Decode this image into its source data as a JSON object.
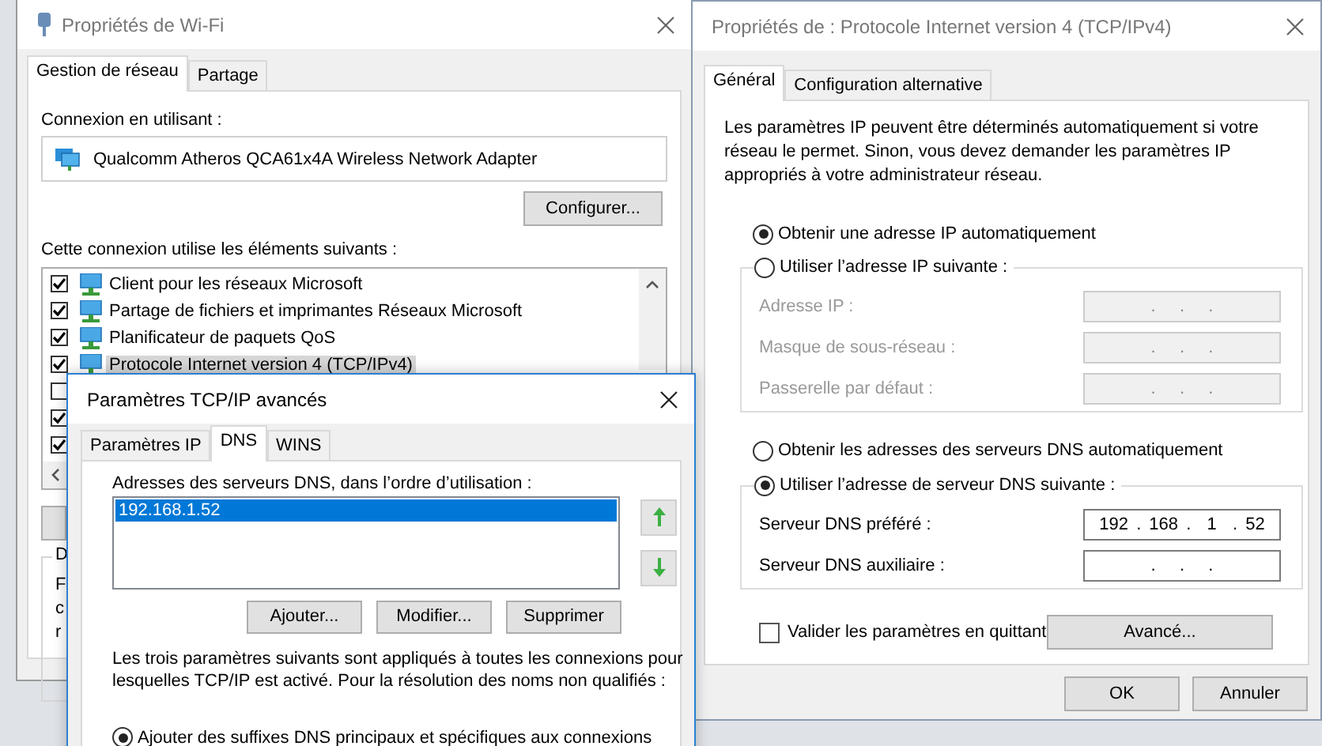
{
  "wifi_window": {
    "title": "Propriétés de Wi-Fi",
    "tabs": [
      {
        "label": "Gestion de réseau",
        "selected": true
      },
      {
        "label": "Partage",
        "selected": false
      }
    ],
    "connect_using_label": "Connexion en utilisant :",
    "adapter": "Qualcomm Atheros QCA61x4A Wireless Network Adapter",
    "configure_button": "Configurer...",
    "components_label": "Cette connexion utilise les éléments suivants :",
    "components": [
      {
        "label": "Client pour les réseaux Microsoft",
        "checked": true,
        "selected": false
      },
      {
        "label": "Partage de fichiers et imprimantes Réseaux Microsoft",
        "checked": true,
        "selected": false
      },
      {
        "label": "Planificateur de paquets QoS",
        "checked": true,
        "selected": false
      },
      {
        "label": "Protocole Internet version 4 (TCP/IPv4)",
        "checked": true,
        "selected": true
      },
      {
        "checked": false
      },
      {
        "checked": true
      },
      {
        "checked": true
      }
    ],
    "group_label": "D",
    "group_lines": [
      "F",
      "c",
      "r"
    ]
  },
  "ipv4_window": {
    "title": "Propriétés de : Protocole Internet version 4 (TCP/IPv4)",
    "tabs": [
      {
        "label": "Général",
        "selected": true
      },
      {
        "label": "Configuration alternative",
        "selected": false
      }
    ],
    "description": "Les paramètres IP peuvent être déterminés automatiquement si votre réseau le permet. Sinon, vous devez demander les paramètres IP appropriés à votre administrateur réseau.",
    "ip_auto": {
      "label": "Obtenir une adresse IP automatiquement",
      "selected": true
    },
    "ip_manual": {
      "label": "Utiliser l’adresse IP suivante :",
      "selected": false
    },
    "ip_fields": [
      {
        "label": "Adresse IP :",
        "value": ".   .   .",
        "disabled": true
      },
      {
        "label": "Masque de sous-réseau :",
        "value": ".   .   .",
        "disabled": true
      },
      {
        "label": "Passerelle par défaut :",
        "value": ".   .   .",
        "disabled": true
      }
    ],
    "dns_auto": {
      "label": "Obtenir les adresses des serveurs DNS automatiquement",
      "selected": false
    },
    "dns_manual": {
      "label": "Utiliser l’adresse de serveur DNS suivante :",
      "selected": true
    },
    "dns_fields": [
      {
        "label": "Serveur DNS préféré :",
        "value": "192 . 168 .  1  . 52",
        "disabled": false
      },
      {
        "label": "Serveur DNS auxiliaire :",
        "value": ".   .   .",
        "disabled": false
      }
    ],
    "validate": {
      "label": "Valider les paramètres en quittant",
      "checked": false
    },
    "advanced_button": "Avancé...",
    "buttons": [
      "OK",
      "Annuler"
    ]
  },
  "advanced_window": {
    "title": "Paramètres TCP/IP avancés",
    "tabs": [
      {
        "label": "Paramètres IP",
        "selected": false
      },
      {
        "label": "DNS",
        "selected": true
      },
      {
        "label": "WINS",
        "selected": false
      }
    ],
    "dns_list_label": "Adresses des serveurs DNS, dans l’ordre d’utilisation :",
    "dns_servers": [
      {
        "address": "192.168.1.52",
        "selected": true
      }
    ],
    "buttons": [
      "Ajouter...",
      "Modifier...",
      "Supprimer"
    ],
    "info": "Les trois paramètres suivants sont appliqués à toutes les connexions pour lesquelles TCP/IP est activé. Pour la résolution des noms non qualifiés :",
    "suffix_options": [
      {
        "label": "Ajouter des suffixes DNS principaux et spécifiques aux connexions",
        "selected": true
      }
    ]
  }
}
